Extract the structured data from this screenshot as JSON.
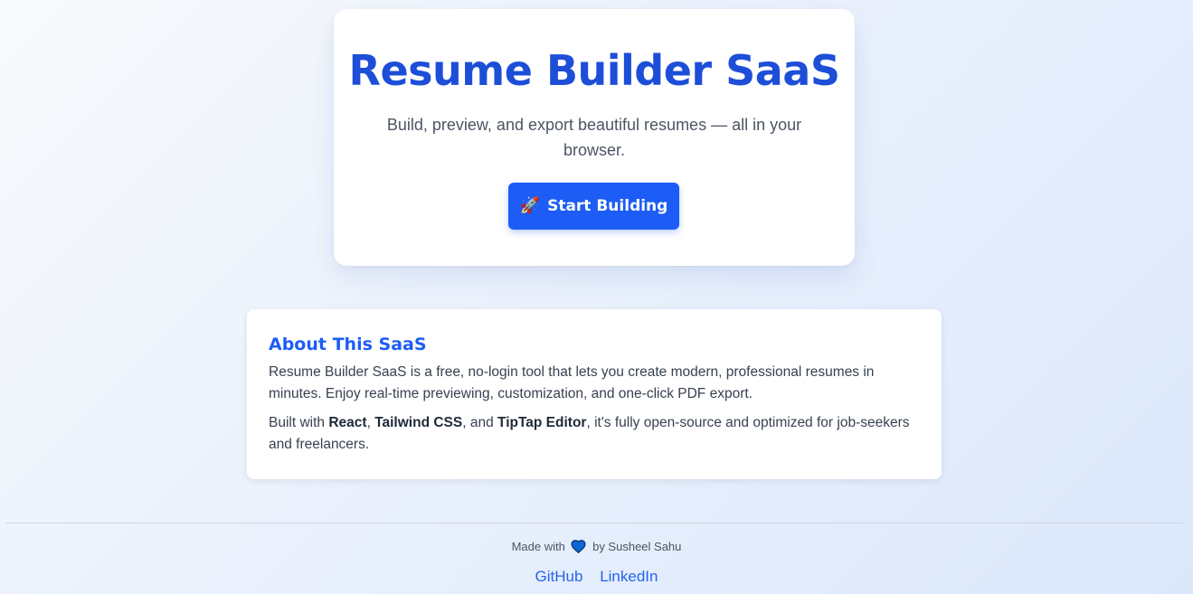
{
  "hero": {
    "title": "Resume Builder SaaS",
    "subtitle": "Build, preview, and export beautiful resumes — all in your browser.",
    "cta_icon": "🚀",
    "cta_label": "Start Building"
  },
  "about": {
    "heading": "About This SaaS",
    "paragraph1": "Resume Builder SaaS is a free, no-login tool that lets you create modern, professional resumes in minutes. Enjoy real-time previewing, customization, and one-click PDF export.",
    "paragraph2_intro": "Built with ",
    "tech_react": "React",
    "sep1": ", ",
    "tech_tailwind": "Tailwind CSS",
    "sep2": ", and ",
    "tech_tiptap": "TipTap Editor",
    "paragraph2_outro": ", it's fully open-source and optimized for job-seekers and freelancers."
  },
  "footer": {
    "made_with": "Made with",
    "heart_icon": "blue-heart-icon",
    "by_text": "by Susheel Sahu",
    "links": [
      {
        "label": "GitHub"
      },
      {
        "label": "LinkedIn"
      }
    ]
  },
  "colors": {
    "primary": "#1d5cf5",
    "title": "#1d4ed8",
    "link": "#2563eb",
    "heart": "#0b66d6"
  }
}
